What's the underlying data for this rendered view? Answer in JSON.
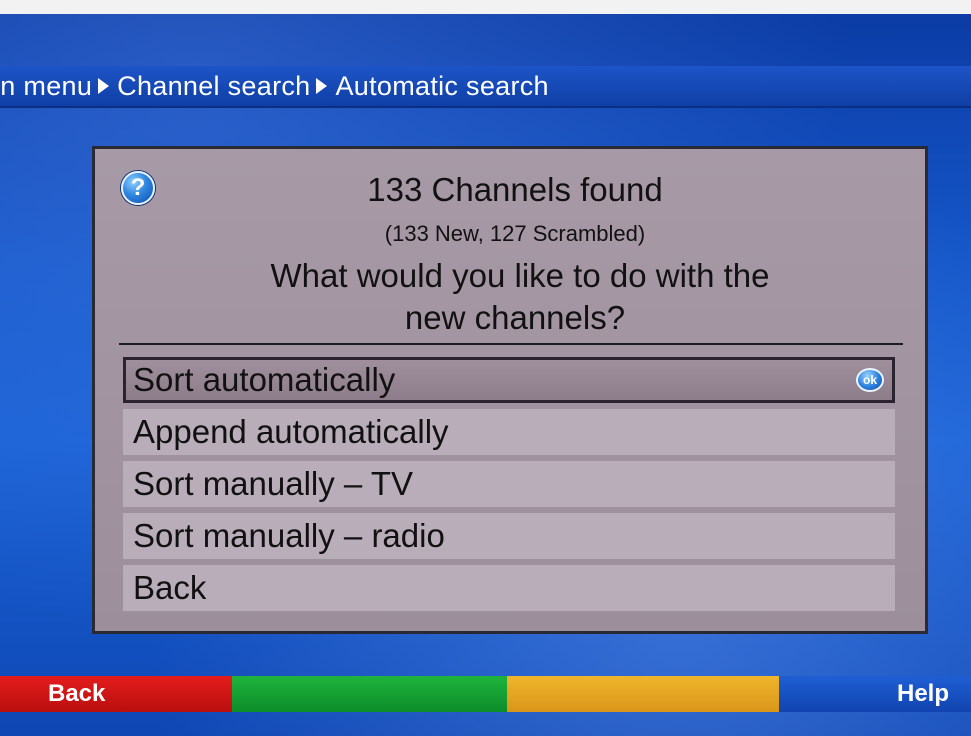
{
  "breadcrumb": {
    "items": [
      "in menu",
      "Channel search",
      "Automatic search"
    ]
  },
  "dialog": {
    "icon": "question-icon",
    "title": "133 Channels found",
    "subtitle": "(133 New, 127 Scrambled)",
    "question_line1": "What would you like to do with the",
    "question_line2": "new channels?",
    "options": [
      {
        "label": "Sort automatically",
        "selected": true
      },
      {
        "label": "Append automatically",
        "selected": false
      },
      {
        "label": "Sort manually – TV",
        "selected": false
      },
      {
        "label": "Sort manually – radio",
        "selected": false
      },
      {
        "label": "Back",
        "selected": false
      }
    ],
    "ok_badge": "ok"
  },
  "color_buttons": {
    "red": {
      "label": "Back",
      "color": "#d41414"
    },
    "green": {
      "label": "",
      "color": "#17a234"
    },
    "yellow": {
      "label": "",
      "color": "#e8a623"
    },
    "blue": {
      "label": "Help",
      "color": "#1a52c4"
    }
  }
}
